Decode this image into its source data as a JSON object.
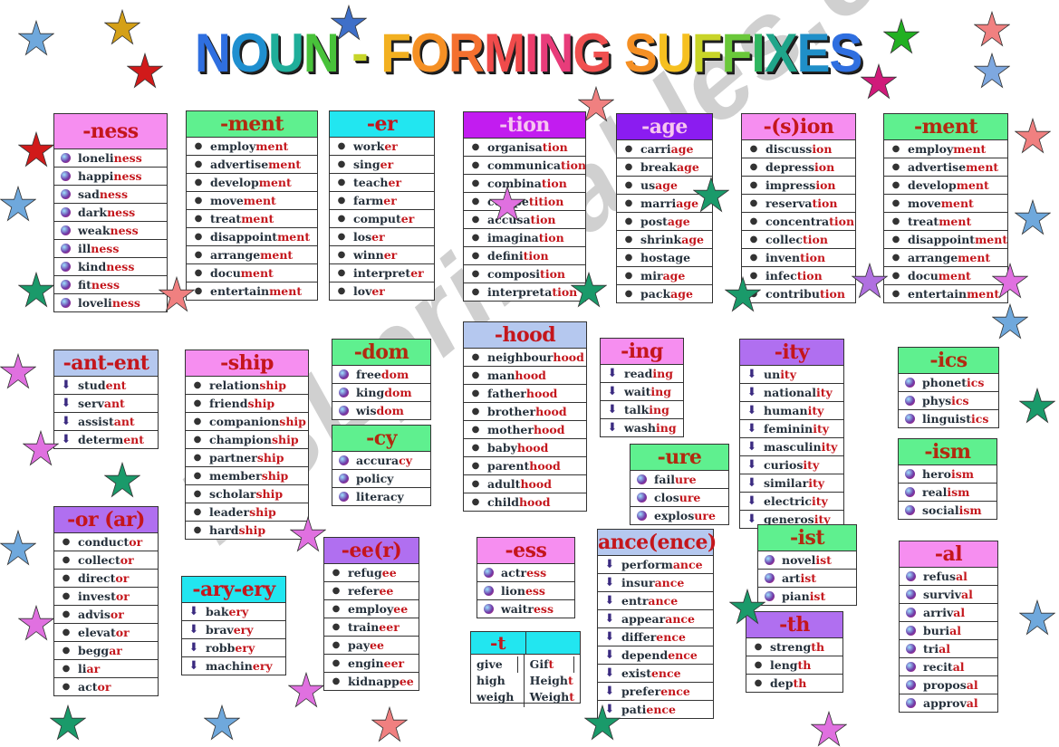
{
  "title": {
    "letters": [
      {
        "ch": "N",
        "color": "#2f6fe0"
      },
      {
        "ch": "O",
        "color": "#1f8fd0"
      },
      {
        "ch": "U",
        "color": "#1fae9a"
      },
      {
        "ch": "N",
        "color": "#48c23a"
      },
      {
        "ch": " - ",
        "color": "#c7d52a"
      },
      {
        "ch": "F",
        "color": "#f2b020"
      },
      {
        "ch": "O",
        "color": "#f59024"
      },
      {
        "ch": "R",
        "color": "#f4702f"
      },
      {
        "ch": "M",
        "color": "#f04b4b"
      },
      {
        "ch": "I",
        "color": "#ec3d6c"
      },
      {
        "ch": "N",
        "color": "#e83c7a"
      },
      {
        "ch": "G",
        "color": "#f05050"
      },
      {
        "ch": " ",
        "color": "#000"
      },
      {
        "ch": "S",
        "color": "#f59024"
      },
      {
        "ch": "U",
        "color": "#f6c020"
      },
      {
        "ch": "F",
        "color": "#c8d428"
      },
      {
        "ch": "F",
        "color": "#6ac83a"
      },
      {
        "ch": "I",
        "color": "#2fb660"
      },
      {
        "ch": "X",
        "color": "#1fa58a"
      },
      {
        "ch": "E",
        "color": "#1f8fc8"
      },
      {
        "ch": "S",
        "color": "#2f6fe0"
      }
    ],
    "text": "NOUN - FORMING SUFFIXES"
  },
  "watermark": "ESLprintables.com",
  "colors": {
    "suffix_red": "#c4161c",
    "word_dark": "#25303b",
    "pink": "#f68ef0",
    "green": "#5ff08f",
    "cyan": "#22e6f0",
    "purple": "#c21cf0",
    "violet": "#8b1cf0",
    "lavender": "#b08ff0",
    "blue_gray": "#b5c8ef"
  },
  "tables": [
    {
      "suffix": "-ness",
      "header_color": "#f68ef0",
      "header_text": "#c4161c",
      "marker": "ball",
      "words": [
        [
          "loneli",
          "ness"
        ],
        [
          "happi",
          "ness"
        ],
        [
          "sad",
          "ness"
        ],
        [
          "dark",
          "ness"
        ],
        [
          "weak",
          "ness"
        ],
        [
          "ill",
          "ness"
        ],
        [
          "kind",
          "ness"
        ],
        [
          "fit",
          "ness"
        ],
        [
          "loveli",
          "ness"
        ]
      ]
    },
    {
      "suffix": "-ment",
      "header_color": "#5ff08f",
      "header_text": "#b22a10",
      "marker": "bullet",
      "words": [
        [
          "employ",
          "ment"
        ],
        [
          "advertise",
          "ment"
        ],
        [
          "develop",
          "ment"
        ],
        [
          "move",
          "ment"
        ],
        [
          "treat",
          "ment"
        ],
        [
          "disappoint",
          "ment"
        ],
        [
          "arrange",
          "ment"
        ],
        [
          "docu",
          "ment"
        ],
        [
          "entertain",
          "ment"
        ]
      ]
    },
    {
      "suffix": "-er",
      "header_color": "#22e6f0",
      "header_text": "#c4161c",
      "marker": "bullet",
      "words": [
        [
          "work",
          "er"
        ],
        [
          "sing",
          "er"
        ],
        [
          "teach",
          "er"
        ],
        [
          "farm",
          "er"
        ],
        [
          "comput",
          "er"
        ],
        [
          "los",
          "er"
        ],
        [
          "winn",
          "er"
        ],
        [
          "interpret",
          "er"
        ],
        [
          "lov",
          "er"
        ]
      ]
    },
    {
      "suffix": "-tion",
      "header_color": "#c21cf0",
      "header_text": "#f7c6ef",
      "marker": "bullet",
      "words": [
        [
          "organisa",
          "tion"
        ],
        [
          "communica",
          "tion"
        ],
        [
          "combina",
          "tion"
        ],
        [
          "compe",
          "tition"
        ],
        [
          "accusa",
          "tion"
        ],
        [
          "imagina",
          "tion"
        ],
        [
          "defini",
          "tion"
        ],
        [
          "composi",
          "tion"
        ],
        [
          "interpreta",
          "tion"
        ]
      ]
    },
    {
      "suffix": "-age",
      "header_color": "#8b1cf0",
      "header_text": "#f7c6ef",
      "marker": "bullet",
      "words": [
        [
          "carri",
          "age"
        ],
        [
          "break",
          "age"
        ],
        [
          "us",
          "age"
        ],
        [
          "marri",
          "age"
        ],
        [
          "post",
          "age"
        ],
        [
          "shrink",
          "age"
        ],
        [
          "hostage",
          ""
        ],
        [
          "mir",
          "age"
        ],
        [
          "pack",
          "age"
        ]
      ]
    },
    {
      "suffix": "-(s)ion",
      "header_color": "#f68ef0",
      "header_text": "#c4161c",
      "marker": "bullet",
      "words": [
        [
          "discuss",
          "ion"
        ],
        [
          "depress",
          "ion"
        ],
        [
          "impress",
          "ion"
        ],
        [
          "reserva",
          "tion"
        ],
        [
          "concentra",
          "tion"
        ],
        [
          "collec",
          "tion"
        ],
        [
          "inven",
          "tion"
        ],
        [
          "infec",
          "tion"
        ],
        [
          "contribu",
          "tion"
        ]
      ]
    },
    {
      "suffix": "-ment",
      "header_color": "#5ff08f",
      "header_text": "#b22a10",
      "marker": "bullet",
      "words": [
        [
          "employ",
          "ment"
        ],
        [
          "advertise",
          "ment"
        ],
        [
          "develop",
          "ment"
        ],
        [
          "move",
          "ment"
        ],
        [
          "treat",
          "ment"
        ],
        [
          "disappoint",
          "ment"
        ],
        [
          "arrange",
          "ment"
        ],
        [
          "docu",
          "ment"
        ],
        [
          "entertain",
          "ment"
        ]
      ]
    },
    {
      "suffix": "-ant-ent",
      "header_color": "#b5c8ef",
      "header_text": "#c4161c",
      "marker": "arrow",
      "words": [
        [
          "stud",
          "ent"
        ],
        [
          "serv",
          "ant"
        ],
        [
          "assist",
          "ant"
        ],
        [
          "determ",
          "ent"
        ]
      ]
    },
    {
      "suffix": "-ship",
      "header_color": "#f68ef0",
      "header_text": "#c4161c",
      "marker": "bullet",
      "words": [
        [
          "relation",
          "ship"
        ],
        [
          "friend",
          "ship"
        ],
        [
          "companion",
          "ship"
        ],
        [
          "champion",
          "ship"
        ],
        [
          "partner",
          "ship"
        ],
        [
          "member",
          "ship"
        ],
        [
          "scholar",
          "ship"
        ],
        [
          "leader",
          "ship"
        ],
        [
          "hard",
          "ship"
        ]
      ]
    },
    {
      "suffix": "-dom",
      "header_color": "#5ff08f",
      "header_text": "#b22a10",
      "marker": "ball",
      "words": [
        [
          "free",
          "dom"
        ],
        [
          "king",
          "dom"
        ],
        [
          "wis",
          "dom"
        ]
      ]
    },
    {
      "suffix": "-cy",
      "header_color": "#5ff08f",
      "header_text": "#b22a10",
      "marker": "ball",
      "words": [
        [
          "accura",
          "cy"
        ],
        [
          "policy",
          ""
        ],
        [
          "literacy",
          ""
        ]
      ]
    },
    {
      "suffix": "-hood",
      "header_color": "#b5c8ef",
      "header_text": "#c4161c",
      "marker": "bullet",
      "words": [
        [
          "neighbour",
          "hood"
        ],
        [
          "man",
          "hood"
        ],
        [
          "father",
          "hood"
        ],
        [
          "brother",
          "hood"
        ],
        [
          "mother",
          "hood"
        ],
        [
          "baby",
          "hood"
        ],
        [
          "parent",
          "hood"
        ],
        [
          "adult",
          "hood"
        ],
        [
          "child",
          "hood"
        ]
      ]
    },
    {
      "suffix": "-ing",
      "header_color": "#f68ef0",
      "header_text": "#c4161c",
      "marker": "arrow",
      "words": [
        [
          "read",
          "ing"
        ],
        [
          "wait",
          "ing"
        ],
        [
          "talk",
          "ing"
        ],
        [
          "wash",
          "ing"
        ]
      ]
    },
    {
      "suffix": "-ure",
      "header_color": "#5ff08f",
      "header_text": "#b22a10",
      "marker": "ball",
      "words": [
        [
          "fail",
          "ure"
        ],
        [
          "clos",
          "ure"
        ],
        [
          "explos",
          "ure"
        ]
      ]
    },
    {
      "suffix": "-ity",
      "header_color": "#b06ff0",
      "header_text": "#c4161c",
      "marker": "arrow",
      "words": [
        [
          "un",
          "ity"
        ],
        [
          "national",
          "ity"
        ],
        [
          "human",
          "ity"
        ],
        [
          "feminin",
          "ity"
        ],
        [
          "masculin",
          "ity"
        ],
        [
          "curios",
          "ity"
        ],
        [
          "similar",
          "ity"
        ],
        [
          "electric",
          "ity"
        ],
        [
          "generos",
          "ity"
        ]
      ]
    },
    {
      "suffix": "-ics",
      "header_color": "#5ff08f",
      "header_text": "#b22a10",
      "marker": "ball",
      "words": [
        [
          "phonet",
          "ics"
        ],
        [
          "phys",
          "ics"
        ],
        [
          "linguist",
          "ics"
        ]
      ]
    },
    {
      "suffix": "-ism",
      "header_color": "#5ff08f",
      "header_text": "#b22a10",
      "marker": "ball",
      "words": [
        [
          "hero",
          "ism"
        ],
        [
          "real",
          "ism"
        ],
        [
          "social",
          "ism"
        ]
      ]
    },
    {
      "suffix": "-or (ar)",
      "header_color": "#b06ff0",
      "header_text": "#c4161c",
      "marker": "bullet",
      "words": [
        [
          "conduct",
          "or"
        ],
        [
          "collect",
          "or"
        ],
        [
          "direct",
          "or"
        ],
        [
          "invest",
          "or"
        ],
        [
          "advis",
          "or"
        ],
        [
          "elevat",
          "or"
        ],
        [
          "begg",
          "ar"
        ],
        [
          "li",
          "ar"
        ],
        [
          "act",
          "or"
        ]
      ]
    },
    {
      "suffix": "-ary-ery",
      "header_color": "#22e6f0",
      "header_text": "#c4161c",
      "marker": "arrow",
      "words": [
        [
          "bak",
          "ery"
        ],
        [
          "brav",
          "ery"
        ],
        [
          "robb",
          "ery"
        ],
        [
          "machin",
          "ery"
        ]
      ]
    },
    {
      "suffix": "-ee(r)",
      "header_color": "#b06ff0",
      "header_text": "#c4161c",
      "marker": "bullet",
      "words": [
        [
          "refug",
          "ee"
        ],
        [
          "refer",
          "ee"
        ],
        [
          "employ",
          "ee"
        ],
        [
          "train",
          "eer"
        ],
        [
          "pay",
          "ee"
        ],
        [
          "engin",
          "eer"
        ],
        [
          "kidnapp",
          "ee"
        ]
      ]
    },
    {
      "suffix": "-ess",
      "header_color": "#f68ef0",
      "header_text": "#c4161c",
      "marker": "ball",
      "words": [
        [
          "actr",
          "ess"
        ],
        [
          "lion",
          "ess"
        ],
        [
          "waitr",
          "ess"
        ]
      ]
    },
    {
      "suffix": "ance(ence)",
      "header_color": "#b5c8ef",
      "header_text": "#c4161c",
      "marker": "arrow",
      "words": [
        [
          "perform",
          "ance"
        ],
        [
          "insur",
          "ance"
        ],
        [
          "entr",
          "ance"
        ],
        [
          "appear",
          "ance"
        ],
        [
          "differ",
          "ence"
        ],
        [
          "depend",
          "ence"
        ],
        [
          "exist",
          "ence"
        ],
        [
          "prefer",
          "ence"
        ],
        [
          "pati",
          "ence"
        ]
      ]
    },
    {
      "suffix": "-ist",
      "header_color": "#5ff08f",
      "header_text": "#b22a10",
      "marker": "ball",
      "words": [
        [
          "novel",
          "ist"
        ],
        [
          "art",
          "ist"
        ],
        [
          "pian",
          "ist"
        ]
      ]
    },
    {
      "suffix": "-th",
      "header_color": "#b06ff0",
      "header_text": "#c4161c",
      "marker": "bullet",
      "words": [
        [
          "streng",
          "th"
        ],
        [
          "leng",
          "th"
        ],
        [
          "dep",
          "th"
        ]
      ]
    },
    {
      "suffix": "-al",
      "header_color": "#f68ef0",
      "header_text": "#c4161c",
      "marker": "ball",
      "words": [
        [
          "refus",
          "al"
        ],
        [
          "surviv",
          "al"
        ],
        [
          "arriv",
          "al"
        ],
        [
          "buri",
          "al"
        ],
        [
          "tri",
          "al"
        ],
        [
          "recit",
          "al"
        ],
        [
          "propos",
          "al"
        ],
        [
          "approv",
          "al"
        ]
      ]
    }
  ],
  "t_table": {
    "suffix": "-t",
    "rows": [
      {
        "base": "give",
        "noun_stem": "Gif",
        "noun_sfx": "t"
      },
      {
        "base": "high",
        "noun_stem": "Heigh",
        "noun_sfx": "t"
      },
      {
        "base": "weigh",
        "noun_stem": "Weigh",
        "noun_sfx": "t"
      }
    ]
  },
  "stars": [
    {
      "color": "#6fa8dc"
    },
    {
      "color": "#d4a017"
    },
    {
      "color": "#d11a1a"
    },
    {
      "color": "#3f6fc8"
    },
    {
      "color": "#f08080"
    },
    {
      "color": "#22b022"
    },
    {
      "color": "#d01a7a"
    },
    {
      "color": "#f08080"
    },
    {
      "color": "#7ea8e0"
    },
    {
      "color": "#d11a1a"
    },
    {
      "color": "#6fa8dc"
    },
    {
      "color": "#1a9a6a"
    },
    {
      "color": "#f08080"
    },
    {
      "color": "#e070e0"
    },
    {
      "color": "#1a9a6a"
    },
    {
      "color": "#e070e0"
    },
    {
      "color": "#1a9a6a"
    },
    {
      "color": "#6fa8dc"
    },
    {
      "color": "#e070e0"
    },
    {
      "color": "#1a9a6a"
    },
    {
      "color": "#e070e0"
    },
    {
      "color": "#1a9a6a"
    },
    {
      "color": "#6fa8dc"
    },
    {
      "color": "#f08080"
    },
    {
      "color": "#1a9a6a"
    },
    {
      "color": "#e070e0"
    },
    {
      "color": "#6fa8dc"
    },
    {
      "color": "#e070e0"
    },
    {
      "color": "#1a9a6a"
    },
    {
      "color": "#f08080"
    },
    {
      "color": "#6fa8dc"
    },
    {
      "color": "#1a9a6a"
    },
    {
      "color": "#e070e0"
    },
    {
      "color": "#6fa8dc"
    },
    {
      "color": "#b070e0"
    },
    {
      "color": "#1a9a6a"
    },
    {
      "color": "#e070e0"
    }
  ]
}
